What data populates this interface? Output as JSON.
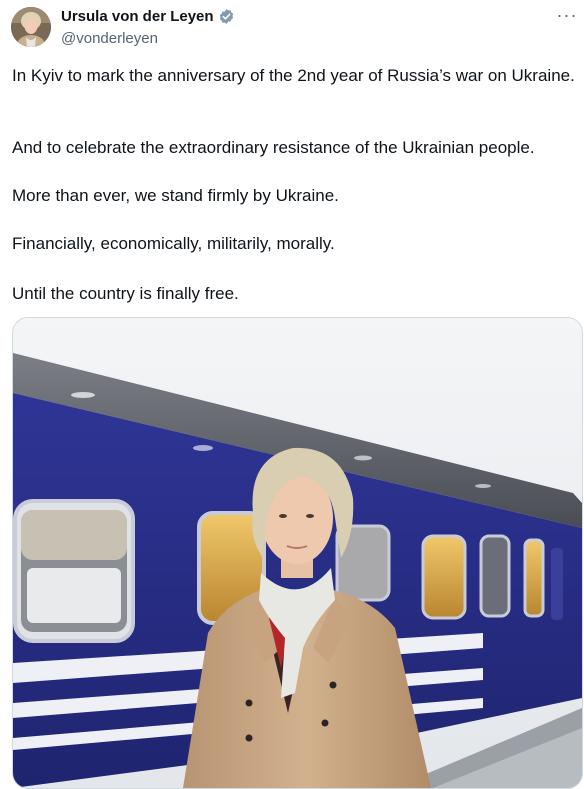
{
  "author": {
    "display_name": "Ursula von der Leyen",
    "handle": "@vonderleyen",
    "verified": true,
    "verified_badge_color": "#829aab"
  },
  "more_menu": {
    "label": "···",
    "icon": "more-horizontal-icon"
  },
  "tweet": {
    "paragraphs": [
      "In Kyiv to mark the anniversary of the 2nd year of Russia’s war on Ukraine.",
      "And to celebrate the extraordinary resistance of the Ukrainian people.",
      "More than ever, we stand firmly by Ukraine.",
      "Financially, economically, militarily, morally.",
      "Until the country is finally free."
    ]
  },
  "media": {
    "type": "photo"
  },
  "colors": {
    "text": "#0f1419",
    "secondary_text": "#536471",
    "border": "#cfd9de",
    "train_blue": "#2b2f8a"
  }
}
